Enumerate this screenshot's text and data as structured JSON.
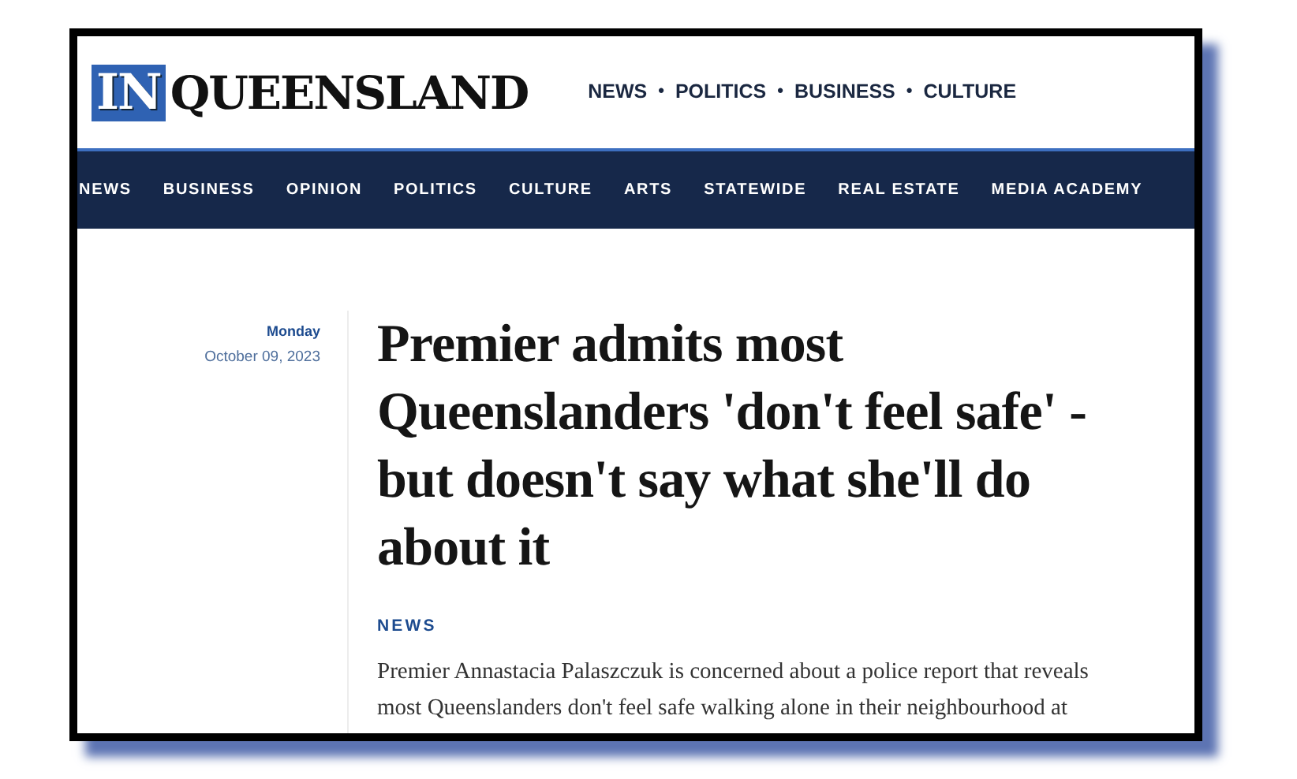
{
  "logo": {
    "badge": "IN",
    "wordmark": "QUEENSLAND"
  },
  "top_links": [
    {
      "kind": "link",
      "text": "NEWS"
    },
    {
      "kind": "separator",
      "text": "•"
    },
    {
      "kind": "link",
      "text": "POLITICS"
    },
    {
      "kind": "separator",
      "text": "•"
    },
    {
      "kind": "link",
      "text": "BUSINESS"
    },
    {
      "kind": "separator",
      "text": "•"
    },
    {
      "kind": "link",
      "text": "CULTURE"
    }
  ],
  "nav": [
    "NEWS",
    "BUSINESS",
    "OPINION",
    "POLITICS",
    "CULTURE",
    "ARTS",
    "STATEWIDE",
    "REAL ESTATE",
    "MEDIA ACADEMY"
  ],
  "article": {
    "day": "Monday",
    "date": "October 09, 2023",
    "headline": "Premier admits most Queenslanders 'don't feel safe' - but doesn't say what she'll do about it",
    "category": "NEWS",
    "body": "Premier Annastacia Palaszczuk is concerned about a police report that reveals most Queenslanders don't feel safe walking alone in their neighbourhood at"
  }
}
